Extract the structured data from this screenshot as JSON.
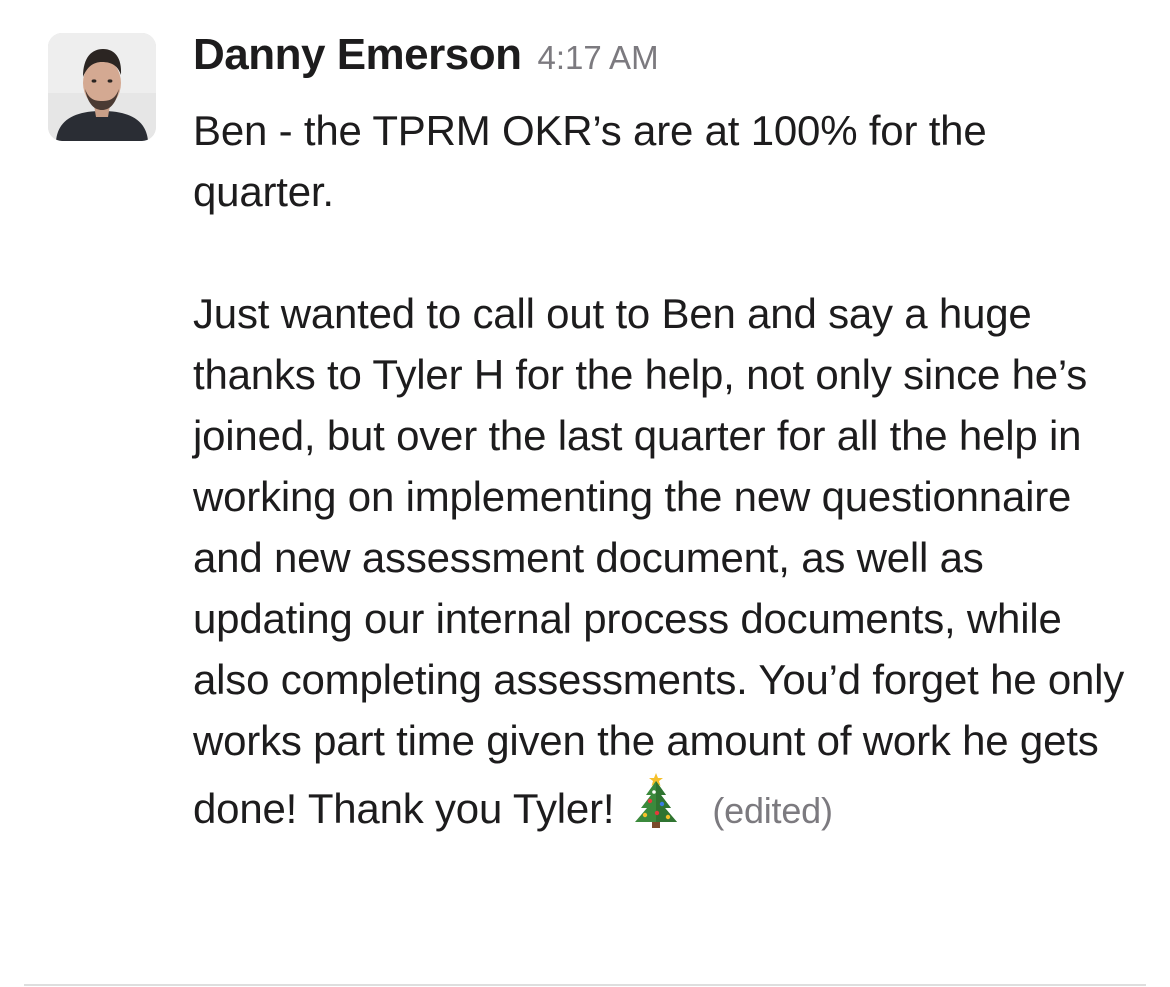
{
  "message": {
    "sender": "Danny Emerson",
    "timestamp": "4:17 AM",
    "paragraph1": "Ben - the TPRM OKR’s are at 100% for the quarter.",
    "paragraph2": "Just wanted to call out to Ben and say a huge thanks to Tyler H for the help, not only since he’s joined, but over the last quarter for all the help in working on implementing the new questionnaire and new assessment document, as well as updating our internal process documents, while also completing assessments. You’d forget he only works part time given the amount of work he gets done! Thank you Tyler!",
    "emoji": "christmas-tree",
    "edited_label": "(edited)"
  },
  "colors": {
    "text": "#1d1c1d",
    "muted": "#7c7a7f",
    "divider": "#dedede"
  }
}
